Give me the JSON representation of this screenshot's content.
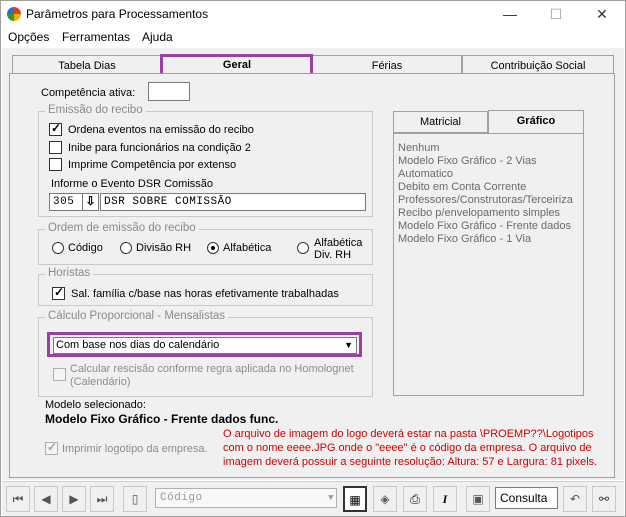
{
  "window": {
    "title": "Parâmetros para Processamentos",
    "minimize": "—",
    "maximize": "☐",
    "close": "✕"
  },
  "menu": {
    "items": [
      "Opções",
      "Ferramentas",
      "Ajuda"
    ]
  },
  "tabs": [
    "Tabela Dias",
    "Geral",
    "Férias",
    "Contribuição Social"
  ],
  "active_tab": "Geral",
  "competencia": {
    "label": "Competência ativa:",
    "value": ""
  },
  "emissao": {
    "title": "Emissão do recibo",
    "options": [
      {
        "label": "Ordena eventos na emissão do recibo",
        "checked": true
      },
      {
        "label": "Inibe para funcionários na condição 2",
        "checked": false
      },
      {
        "label": "Imprime Competência por extenso",
        "checked": false
      }
    ],
    "dsr_label": "Informe o Evento DSR Comissão",
    "dsr_code": "305",
    "dsr_desc": "DSR SOBRE COMISSÃO"
  },
  "ordem": {
    "title": "Ordem de emissão do recibo",
    "options": [
      "Código",
      "Divisão RH",
      "Alfabética",
      "Alfabética",
      "Div. RH"
    ],
    "selected": "Alfabética"
  },
  "horistas": {
    "title": "Horistas",
    "option": "Sal. família c/base nas horas efetivamente trabalhadas",
    "checked": true
  },
  "calculo": {
    "title": "Cálculo Proporcional - Mensalistas",
    "select_value": "Com base nos dias do calendário",
    "rescisao_line1": "Calcular rescisão conforme regra aplicada no Homolognet",
    "rescisao_line2": "(Calendário)"
  },
  "modelo": {
    "label": "Modelo selecionado:",
    "value": "Modelo Fixo Gráfico - Frente dados func.",
    "logo_option": "Imprimir logotipo da empresa.",
    "note": "O arquivo de imagem do logo deverá estar na pasta \\PROEMP??\\Logotipos com o nome eeee.JPG onde o \"eeee\" é o código da empresa. O arquivo de imagem deverá possuir a seguinte resolução: Altura: 57 e Largura: 81 pixels."
  },
  "side_tabs": [
    "Matricial",
    "Gráfico"
  ],
  "side_active": "Gráfico",
  "modelos_list": [
    "Nenhum",
    "Modelo Fixo Gráfico - 2 Vias",
    "Automatico",
    "Debito em Conta Corrente",
    "Professores/Construtoras/Terceiriza",
    "Recibo p/envelopamento simples",
    "Modelo Fixo Gráfico - Frente dados",
    "Modelo Fixo Gráfico - 1 Via"
  ],
  "toolbar": {
    "codigo_placeholder": "Código",
    "mode": "Consulta"
  },
  "colors": {
    "highlight": "#9b3fa3",
    "note": "#d00000"
  }
}
